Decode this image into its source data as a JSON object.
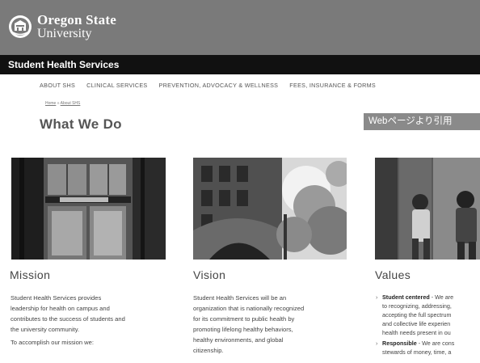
{
  "header": {
    "logo_line1": "Oregon State",
    "logo_line2": "University",
    "unit_title": "Student Health Services"
  },
  "nav": {
    "items": [
      "ABOUT SHS",
      "CLINICAL SERVICES",
      "PREVENTION, ADVOCACY & WELLNESS",
      "FEES, INSURANCE & FORMS"
    ]
  },
  "breadcrumb": {
    "home": "Home",
    "separator": " » ",
    "current": "About SHS"
  },
  "page_title": "What We Do",
  "caption": "Webページより引用",
  "columns": {
    "mission": {
      "title": "Mission",
      "text": [
        "Student Health Services provides",
        "leadership for health on campus and",
        "contributes to the success of students and",
        "the university community."
      ],
      "extra": "To accomplish our mission we:"
    },
    "vision": {
      "title": "Vision",
      "text": [
        "Student Health Services will be an",
        "organization that is nationally recognized",
        "for its commitment to public health by",
        "promoting lifelong healthy behaviors,",
        "healthy environments, and global",
        "citizenship."
      ]
    },
    "values": {
      "title": "Values",
      "items": [
        {
          "head": "Student centered",
          "lines": [
            " - We are",
            "to recognizing, addressing,",
            "accepting the full spectrum",
            "and collective life experien",
            "health needs present in ou"
          ]
        },
        {
          "head": "Responsible",
          "lines": [
            " - We are cons",
            "stewards of money, time, a"
          ]
        }
      ]
    }
  }
}
